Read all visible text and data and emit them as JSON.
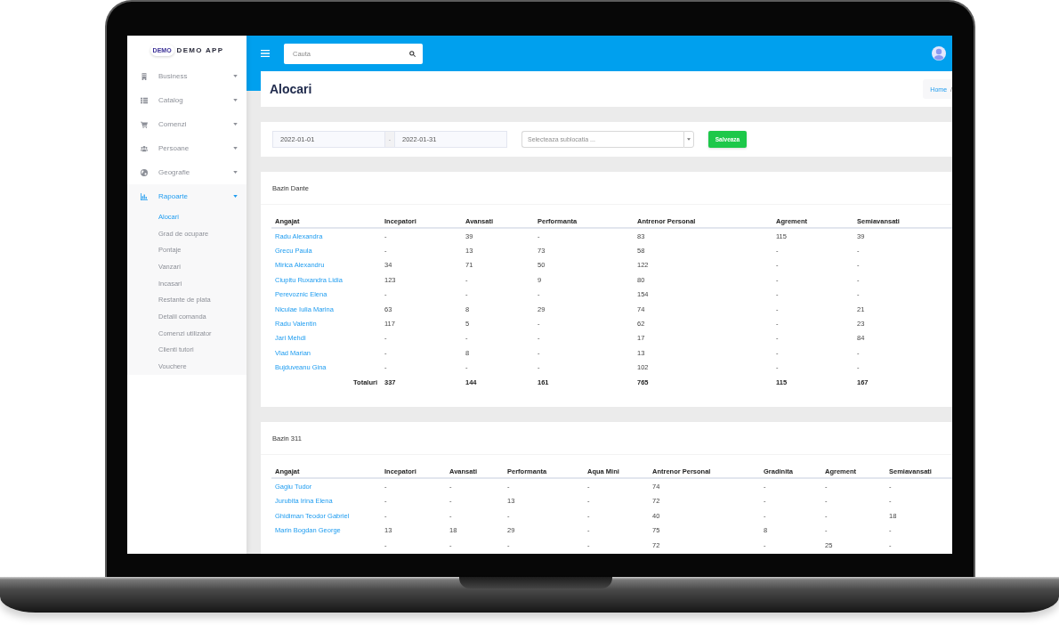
{
  "sidebar": {
    "logo": {
      "mark": "DEMO",
      "title": "DEMO APP"
    },
    "items": [
      {
        "label": "Business",
        "expanded": false
      },
      {
        "label": "Catalog",
        "expanded": false
      },
      {
        "label": "Comenzi",
        "expanded": false
      },
      {
        "label": "Persoane",
        "expanded": false
      },
      {
        "label": "Geografie",
        "expanded": false
      },
      {
        "label": "Rapoarte",
        "expanded": true,
        "children": [
          {
            "label": "Alocari",
            "selected": true
          },
          {
            "label": "Grad de ocupare",
            "selected": false
          },
          {
            "label": "Pontaje",
            "selected": false
          },
          {
            "label": "Vanzari",
            "selected": false
          },
          {
            "label": "Incasari",
            "selected": false
          },
          {
            "label": "Restante de plata",
            "selected": false
          },
          {
            "label": "Detalii comanda",
            "selected": false
          },
          {
            "label": "Comenzi utilizator",
            "selected": false
          },
          {
            "label": "Clienti tutori",
            "selected": false
          },
          {
            "label": "Vouchere",
            "selected": false
          }
        ]
      }
    ]
  },
  "top_bar": {
    "search": {
      "placeholder": "Cauta"
    }
  },
  "page_header": {
    "title": "Alocari",
    "breadcrumb": [
      {
        "kind": "link",
        "label": "Home"
      },
      {
        "kind": "separator",
        "label": "/"
      }
    ]
  },
  "filters": {
    "date_from": "2022-01-01",
    "range_separator": "-",
    "date_to": "2022-01-31",
    "sublocation": {
      "placeholder": "Selecteaza sublocatia ..."
    },
    "save_button": "Salveaza"
  },
  "reports": [
    {
      "title": "Bazin Dante",
      "table": {
        "columns": [
          "Angajat",
          "Incepatori",
          "Avansati",
          "Performanta",
          "Antrenor Personal",
          "Agrement",
          "Semiavansati"
        ],
        "rows": [
          {
            "kind": "employee",
            "cells": [
              "Radu Alexandra",
              "-",
              "39",
              "-",
              "83",
              "115",
              "39"
            ]
          },
          {
            "kind": "employee",
            "cells": [
              "Grecu Paula",
              "-",
              "13",
              "73",
              "58",
              "-",
              "-"
            ]
          },
          {
            "kind": "employee",
            "cells": [
              "Mirica Alexandru",
              "34",
              "71",
              "50",
              "122",
              "-",
              "-"
            ]
          },
          {
            "kind": "employee",
            "cells": [
              "Ciupitu Ruxandra Lidia",
              "123",
              "-",
              "9",
              "80",
              "-",
              "-"
            ]
          },
          {
            "kind": "employee",
            "cells": [
              "Perevoznic Elena",
              "-",
              "-",
              "-",
              "154",
              "-",
              "-"
            ]
          },
          {
            "kind": "employee",
            "cells": [
              "Niculae Iulia Marina",
              "63",
              "8",
              "29",
              "74",
              "-",
              "21"
            ]
          },
          {
            "kind": "employee",
            "cells": [
              "Radu Valentin",
              "117",
              "5",
              "-",
              "62",
              "-",
              "23"
            ]
          },
          {
            "kind": "employee",
            "cells": [
              "Jari Mehdi",
              "-",
              "-",
              "-",
              "17",
              "-",
              "84"
            ]
          },
          {
            "kind": "employee",
            "cells": [
              "Vlad Marian",
              "-",
              "8",
              "-",
              "13",
              "-",
              "-"
            ]
          },
          {
            "kind": "employee",
            "cells": [
              "Bujduveanu Gina",
              "-",
              "-",
              "-",
              "102",
              "-",
              "-"
            ]
          },
          {
            "kind": "totals",
            "cells": [
              "Totaluri",
              "337",
              "144",
              "161",
              "765",
              "115",
              "167"
            ]
          }
        ]
      }
    },
    {
      "title": "Bazin 311",
      "table": {
        "columns": [
          "Angajat",
          "Incepatori",
          "Avansati",
          "Performanta",
          "Aqua Mini",
          "Antrenor Personal",
          "Gradinita",
          "Agrement",
          "Semiavansati"
        ],
        "rows": [
          {
            "kind": "employee",
            "cells": [
              "Gagiu Tudor",
              "-",
              "-",
              "-",
              "-",
              "74",
              "-",
              "-",
              "-"
            ]
          },
          {
            "kind": "employee",
            "cells": [
              "Jurubita Irina Elena",
              "-",
              "-",
              "13",
              "-",
              "72",
              "-",
              "-",
              "-"
            ]
          },
          {
            "kind": "employee",
            "cells": [
              "Ghidiman Teodor Gabriel",
              "-",
              "-",
              "-",
              "-",
              "40",
              "-",
              "-",
              "18"
            ]
          },
          {
            "kind": "employee",
            "cells": [
              "Marin Bogdan George",
              "13",
              "18",
              "29",
              "-",
              "75",
              "8",
              "-",
              "-"
            ]
          },
          {
            "kind": "employee",
            "cells": [
              "",
              "-",
              "-",
              "-",
              "-",
              "72",
              "-",
              "25",
              "-"
            ]
          }
        ]
      }
    }
  ]
}
